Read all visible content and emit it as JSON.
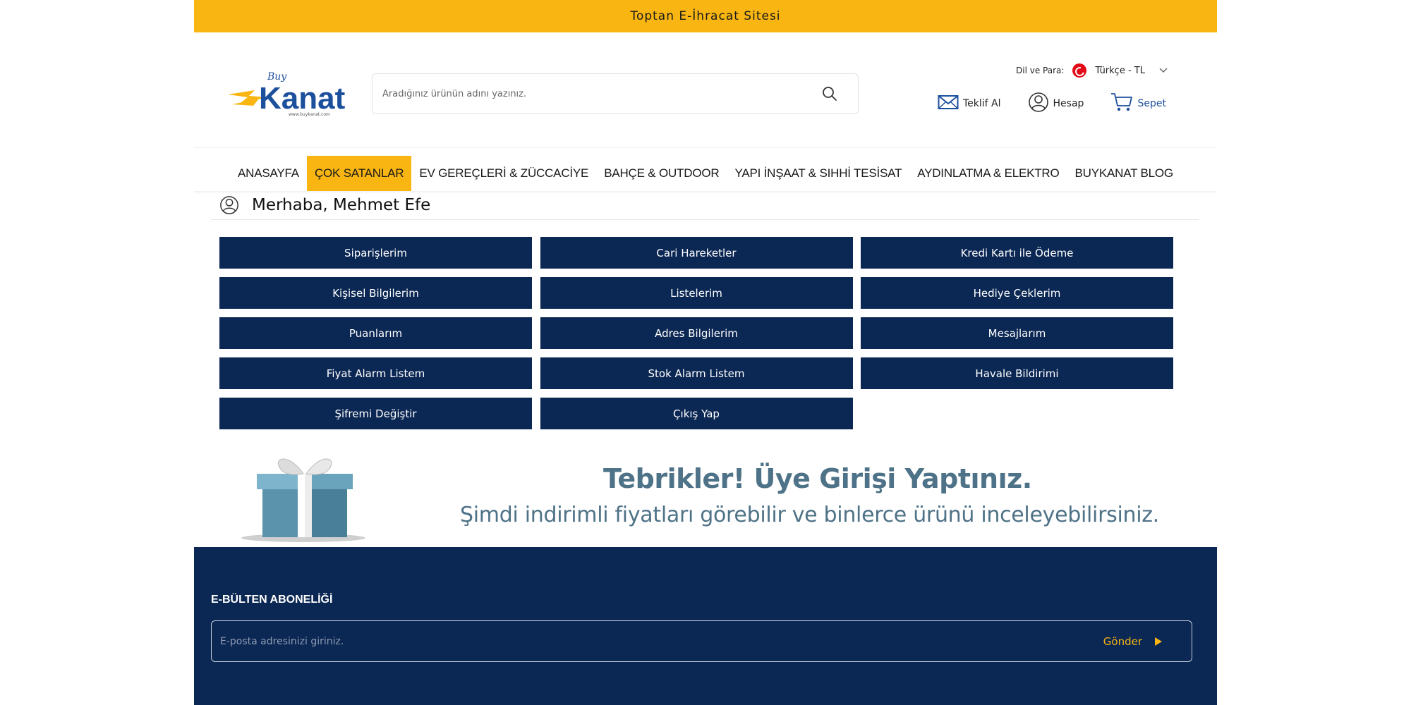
{
  "topbar": {
    "text": "Toptan E-İhracat Sitesi"
  },
  "logo": {
    "brand_top": "Buy",
    "brand_main": "Kanat",
    "brand_url": "www.buykanat.com"
  },
  "search": {
    "placeholder": "Aradığınız ürünün adını yazınız."
  },
  "lang": {
    "label": "Dil ve Para:",
    "value": "Türkçe - TL"
  },
  "actions": {
    "quote": "Teklif Al",
    "account": "Hesap",
    "cart": "Sepet"
  },
  "nav": [
    "ANASAYFA",
    "ÇOK SATANLAR",
    "EV GEREÇLERİ & ZÜCCACİYE",
    "BAHÇE & OUTDOOR",
    "YAPI İNŞAAT & SIHHİ TESİSAT",
    "AYDINLATMA & ELEKTRO",
    "BUYKANAT BLOG"
  ],
  "greeting": "Merhaba, Mehmet Efe",
  "account_menu": [
    "Siparişlerim",
    "Cari Hareketler",
    "Kredi Kartı ile Ödeme",
    "Kişisel Bilgilerim",
    "Listelerim",
    "Hediye Çeklerim",
    "Puanlarım",
    "Adres Bilgilerim",
    "Mesajlarım",
    "Fiyat Alarm Listem",
    "Stok Alarm Listem",
    "Havale Bildirimi",
    "Şifremi Değiştir",
    "Çıkış Yap"
  ],
  "banner": {
    "headline": "Tebrikler! Üye Girişi Yaptınız.",
    "subline": "Şimdi indirimli fiyatları görebilir ve binlerce ürünü inceleyebilirsiniz."
  },
  "newsletter": {
    "title": "E-BÜLTEN ABONELİĞİ",
    "placeholder": "E-posta adresinizi giriniz.",
    "submit": "Gönder"
  },
  "colors": {
    "accent": "#f9b612",
    "navy": "#0b2753",
    "banner_text": "#4e7287",
    "cart_blue": "#1c4f9c"
  },
  "icons": {
    "search": "search-icon",
    "mail": "mail-icon",
    "user": "user-icon",
    "cart": "cart-icon",
    "flag": "turkey-flag-icon",
    "chevron": "chevron-down-icon",
    "gift": "gift-box-icon",
    "play": "play-arrow-icon"
  }
}
